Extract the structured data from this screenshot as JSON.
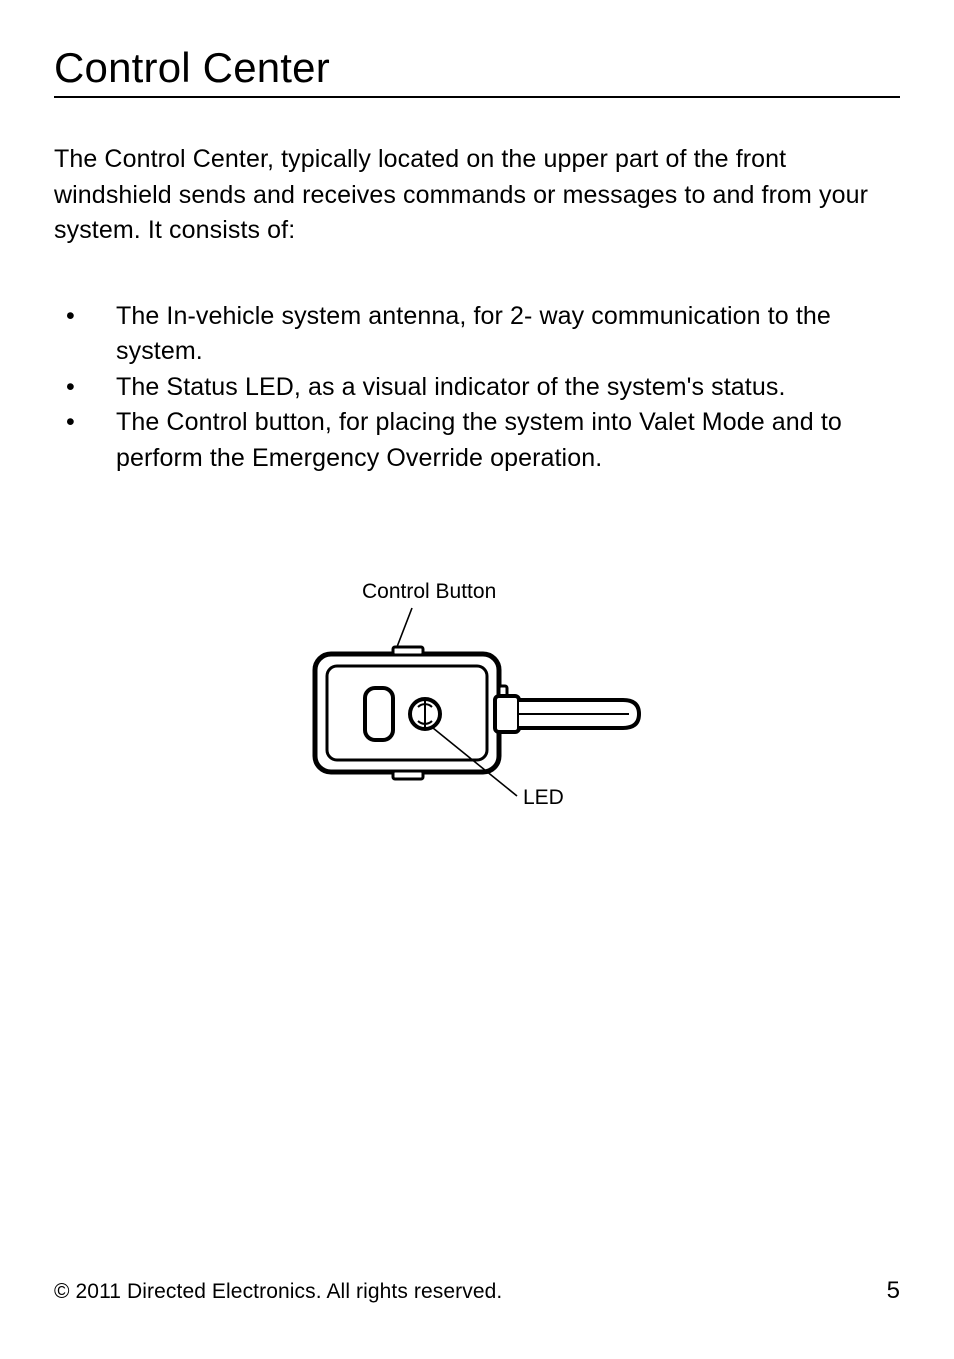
{
  "title": "Control Center",
  "intro": "The Control Center, typically located on the upper part of the front windshield sends and receives commands or messages to and from your system. It consists of:",
  "bullets": [
    "The In-vehicle system antenna, for 2- way communication to the system.",
    "The Status LED, as  a visual indicator of the system's status.",
    "The Control button, for placing the system into Valet Mode and to perform the  Emergency Override operation."
  ],
  "figure": {
    "label_control_button": "Control Button",
    "label_led": "LED"
  },
  "footer": {
    "copyright": "© 2011 Directed Electronics. All rights reserved.",
    "page_number": "5"
  }
}
